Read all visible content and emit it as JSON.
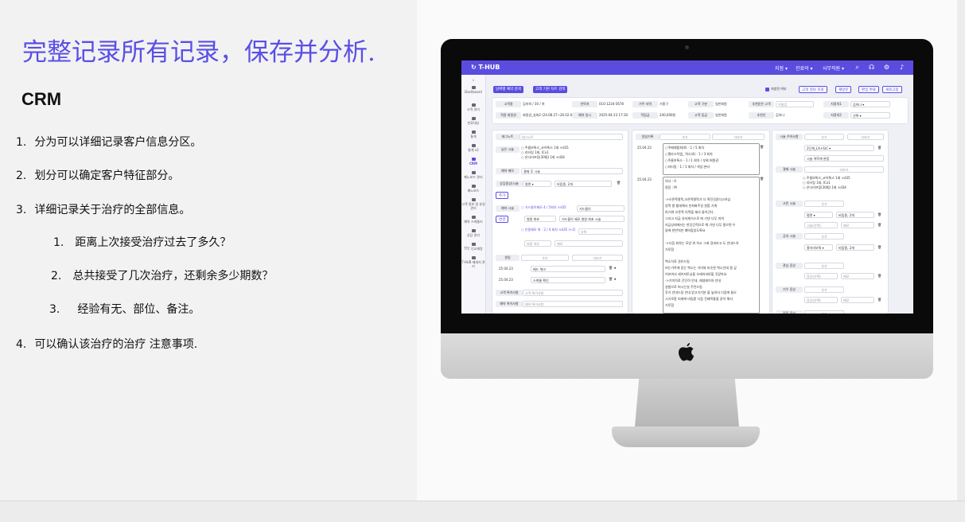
{
  "slide": {
    "title": "完整记录所有记录，保存并分析.",
    "heading": "CRM",
    "items": [
      {
        "num": "1.",
        "text": "分为可以详细记录客户信息分区。"
      },
      {
        "num": "2.",
        "text": "划分可以确定客户特征部分。"
      },
      {
        "num": "3.",
        "text": "详细记录关于治疗的全部信息。"
      },
      {
        "num": "1.",
        "text": "距离上次接受治疗过去了多久？"
      },
      {
        "num": "2.",
        "text": "总共接受了几次治疗，还剩余多少期数？"
      },
      {
        "num": "3.",
        "text": "经验有无、部位、备注。"
      },
      {
        "num": "4.",
        "text": "可以确认该治疗的治疗 注意事项."
      }
    ]
  },
  "app": {
    "brand": "T-HUB",
    "menu": [
      "지점 ▾",
      "진료의 ▾",
      "사무직원 ▾"
    ],
    "icons": [
      "search-icon",
      "headset-icon",
      "gear-icon",
      "bell-icon"
    ],
    "accent": "#5b4ce0",
    "sidebar": [
      "»",
      "Dashboard",
      "고객 관리",
      "만료대상",
      "통계",
      "통계 v2",
      "CRM",
      "패노보드 관리",
      "패노보드",
      "고객 정보 및 분류 관리",
      "예약 스케줄러",
      "상담 관리",
      "TTC 인교재량",
      "T-HUB 패세지 관리"
    ],
    "top_buttons": [
      "날짜별 예약 검색",
      "고객 기본 차트 검색"
    ],
    "right_buttons": [
      "고객 정보 조회",
      "재방문",
      "편집 완료",
      "새로고침"
    ],
    "check_label": "처방전 여부",
    "info": {
      "row1": [
        {
          "label": "고객명",
          "value": "김미희 / 30 / 여"
        },
        {
          "label": "연락처",
          "value": "010-1234-5678"
        },
        {
          "label": "거주 지역",
          "value": "기흥구"
        },
        {
          "label": "고객 구분",
          "value": "일반회원"
        },
        {
          "label": "추천받은 고객",
          "value": "이름검"
        },
        {
          "label": "지정의1",
          "value": "김하나"
        }
      ],
      "row2": [
        {
          "label": "적용 회원권",
          "value": "회원권_실버2 (24.08.27~26.02.06)"
        },
        {
          "label": "예약 일시",
          "value": "2025-04-23 17:30"
        },
        {
          "label": "적립금",
          "value": "240,000원"
        },
        {
          "label": "고객 등급",
          "value": "일반회원"
        },
        {
          "label": "추천인",
          "value": "김하나"
        },
        {
          "label": "지정의2",
          "value": "선택"
        }
      ]
    },
    "left_card": {
      "tags_label": "태그노트",
      "tags_placeholder": "태그노트",
      "past_label": "남은 시술",
      "past_lines": [
        "○ 주름보톡스_코어톡스 1회 ×d35",
        "○ 리터링 1회, ICx1",
        "○ 온다리프팅(300J) 1회 ×d34"
      ],
      "reserve_label": "예약 메모",
      "reserve_value": "결제 후 시술",
      "consult_label": "상담중상(시술",
      "consult_select": "평면",
      "consult_value": "비립종, 2개",
      "add_label": "추가",
      "booking_label": "예약 시술",
      "booking_item": "○ 거드름이제모 4 / 5회차 ×d35",
      "booking_value": "거드름이",
      "change_label": "변경",
      "change_value": "병원 최초",
      "change_note": "거드름이 제모 병원 최초 시술",
      "followup_item": "○ 인중제모 위 : 2 / 4 회차 ×d35 (+2)",
      "followup_placeholder": "부위",
      "followup_sub": "외종 여부",
      "followup_memo": "메모",
      "exam_label": "원일",
      "exam_add": "추가",
      "exam_more": "더보기",
      "exams": [
        {
          "date": "25.04.23",
          "value": "베드 체크"
        },
        {
          "date": "25.04.23",
          "value": "스케줄 확인"
        }
      ],
      "note1_label": "고객 특이사항",
      "note1_placeholder": "고객 특이사항",
      "note2_label": "예약 특이사항",
      "note2_placeholder": "예약 특이사항"
    },
    "middle_card": {
      "title": "일일기록",
      "add_label": "추가",
      "more_label": "더보기",
      "entries": [
        {
          "date": "25.04.23",
          "lines": [
            "○주베제품회(6) - 1 / 5 회차",
            "○엘라스틱엠_ 역스(4) - 1 / 3 회차",
            "○주름보톡스 - 1 / 1 회차 / 부위:회원권",
            "○리터링 - 1 / 1 회차 / 색상:본타"
          ]
        },
        {
          "date": "25.04.23",
          "lines": [
            "의사 : A",
            "원장 : M",
            "",
            "->오른쪽팔뚝,오른쪽팔뚝가 더 껴진것같다고하심",
            "양쪽 팔 봤세해서 만쳐봐주길 원함 기계",
            "4)거여 오른쪽 뒤쪽을 제서 들어간다.",
            "그리고 지금 유지제거스로 에 기넨 너무 꺼져",
            "지금상태에서는 한당간적으로 해 기넨 너무 팔으면 두",
            "달에 한번씩만 예약잡았도록요",
            "",
            "->다음 회차는 모양 위 하고 그래 경과보고 도 안내드려",
            "기로함",
            "",
            "백소치료 권유드림",
            "비는가목에 있는 백소는 기미와 비슷한 백소인데 좀 깊",
            "어보여서 레이저토닝을 오래하셔야할 것같아요",
            "->기미치료 간단히 안내, 제생레이저 안내",
            "실험으로 머시는실 주전드림",
            "후기 안내드림 안내 받고기기분 돌 높여서 다음에 들오",
            "시기로함 미래에 비립종 다음 진배목통을 같이 해서",
            "기로함"
          ]
        }
      ]
    },
    "right_card": {
      "sections": [
        {
          "label": "시술 주의사항",
          "add": "추가",
          "more": "더보기",
          "select": "2단계_LX+S/C",
          "value": "시술 역학계 완함"
        },
        {
          "label": "결제 시술",
          "more": "더보기",
          "lines": [
            "○ 주름보톡스_코어톡스 1회 ×d35",
            "○ 리터링 1회, ICx1",
            "○ 온다리프팅(300J) 1회 ×d34"
          ]
        },
        {
          "label": "고민 시술",
          "add": "추가",
          "select": "평면",
          "value": "비립종, 2개",
          "sub": "시술(선택)",
          "memo": "메모"
        },
        {
          "label": "공지 시술",
          "add": "추가",
          "select": "홍아리보톡",
          "value": "비립종, 2개"
        },
        {
          "label": "관심 증상",
          "add": "추가",
          "sub": "증상(선택)",
          "memo": "메모"
        },
        {
          "label": "기우 증상",
          "add": "추가",
          "sub": "증상(선택)",
          "memo": "메모"
        },
        {
          "label": "진료 증상",
          "add": "추가"
        }
      ],
      "side_button": "등록"
    }
  }
}
